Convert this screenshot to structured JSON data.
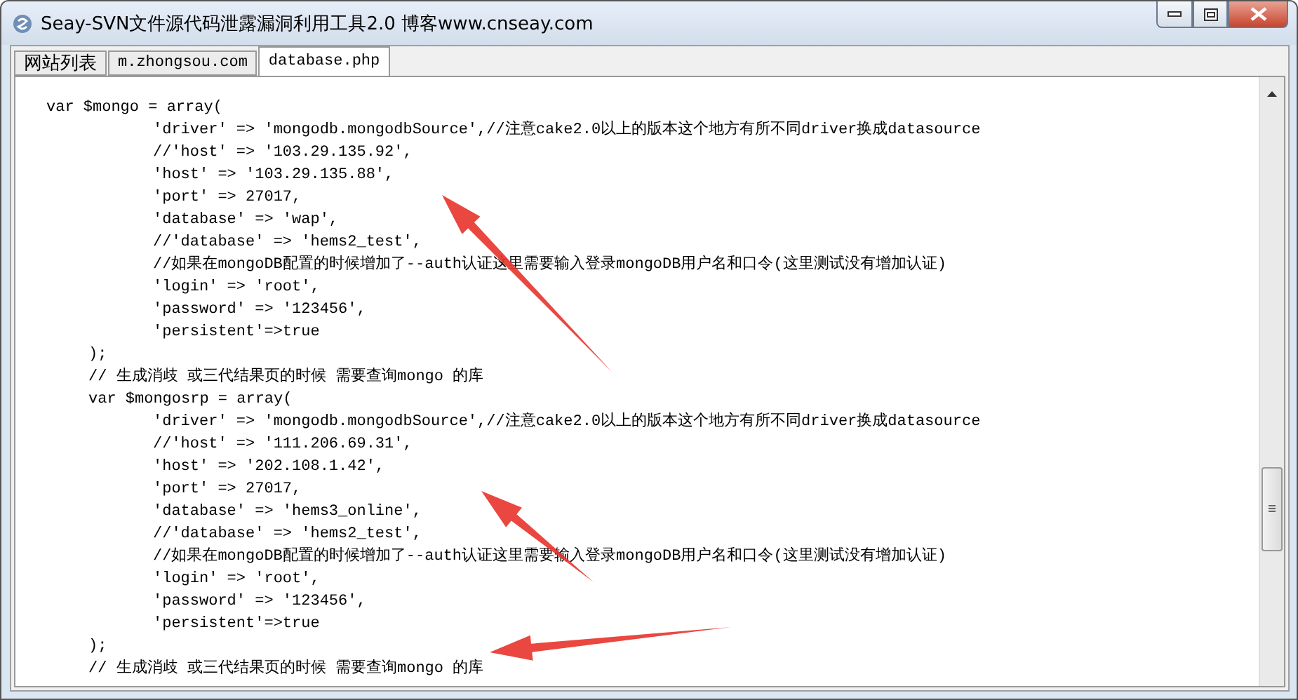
{
  "window": {
    "title": "Seay-SVN文件源代码泄露漏洞利用工具2.0  博客www.cnseay.com"
  },
  "tabs": [
    {
      "label": "网站列表",
      "selected": false,
      "kind": "ui"
    },
    {
      "label": "m.zhongsou.com",
      "selected": false,
      "kind": "mono"
    },
    {
      "label": "database.php",
      "selected": true,
      "kind": "mono"
    }
  ],
  "code_lines": [
    {
      "kind": "top",
      "text": "var $mongo = array("
    },
    {
      "kind": "field",
      "text": "'driver' => 'mongodb.mongodbSource',//注意cake2.0以上的版本这个地方有所不同driver换成datasource"
    },
    {
      "kind": "field",
      "text": "//'host' => '103.29.135.92',"
    },
    {
      "kind": "field",
      "text": "'host' => '103.29.135.88',"
    },
    {
      "kind": "field",
      "text": "'port' => 27017,"
    },
    {
      "kind": "field",
      "text": "'database' => 'wap',"
    },
    {
      "kind": "field",
      "text": "//'database' => 'hems2_test',"
    },
    {
      "kind": "field",
      "text": "//如果在mongoDB配置的时候增加了--auth认证这里需要输入登录mongoDB用户名和口令(这里测试没有增加认证)"
    },
    {
      "kind": "field",
      "text": "'login' => 'root',"
    },
    {
      "kind": "field",
      "text": "'password' => '123456',"
    },
    {
      "kind": "field",
      "text": "'persistent'=>true"
    },
    {
      "kind": "block",
      "text": ");"
    },
    {
      "kind": "block",
      "text": "// 生成消歧 或三代结果页的时候 需要查询mongo 的库"
    },
    {
      "kind": "block",
      "text": "var $mongosrp = array("
    },
    {
      "kind": "field",
      "text": "'driver' => 'mongodb.mongodbSource',//注意cake2.0以上的版本这个地方有所不同driver换成datasource"
    },
    {
      "kind": "field",
      "text": "//'host' => '111.206.69.31',"
    },
    {
      "kind": "field",
      "text": "'host' => '202.108.1.42',"
    },
    {
      "kind": "field",
      "text": "'port' => 27017,"
    },
    {
      "kind": "field",
      "text": "'database' => 'hems3_online',"
    },
    {
      "kind": "field",
      "text": "//'database' => 'hems2_test',"
    },
    {
      "kind": "field",
      "text": "//如果在mongoDB配置的时候增加了--auth认证这里需要输入登录mongoDB用户名和口令(这里测试没有增加认证)"
    },
    {
      "kind": "field",
      "text": "'login' => 'root',"
    },
    {
      "kind": "field",
      "text": "'password' => '123456',"
    },
    {
      "kind": "field",
      "text": "'persistent'=>true"
    },
    {
      "kind": "block",
      "text": ");"
    },
    {
      "kind": "block",
      "text": "// 生成消歧 或三代结果页的时候 需要查询mongo 的库"
    }
  ]
}
